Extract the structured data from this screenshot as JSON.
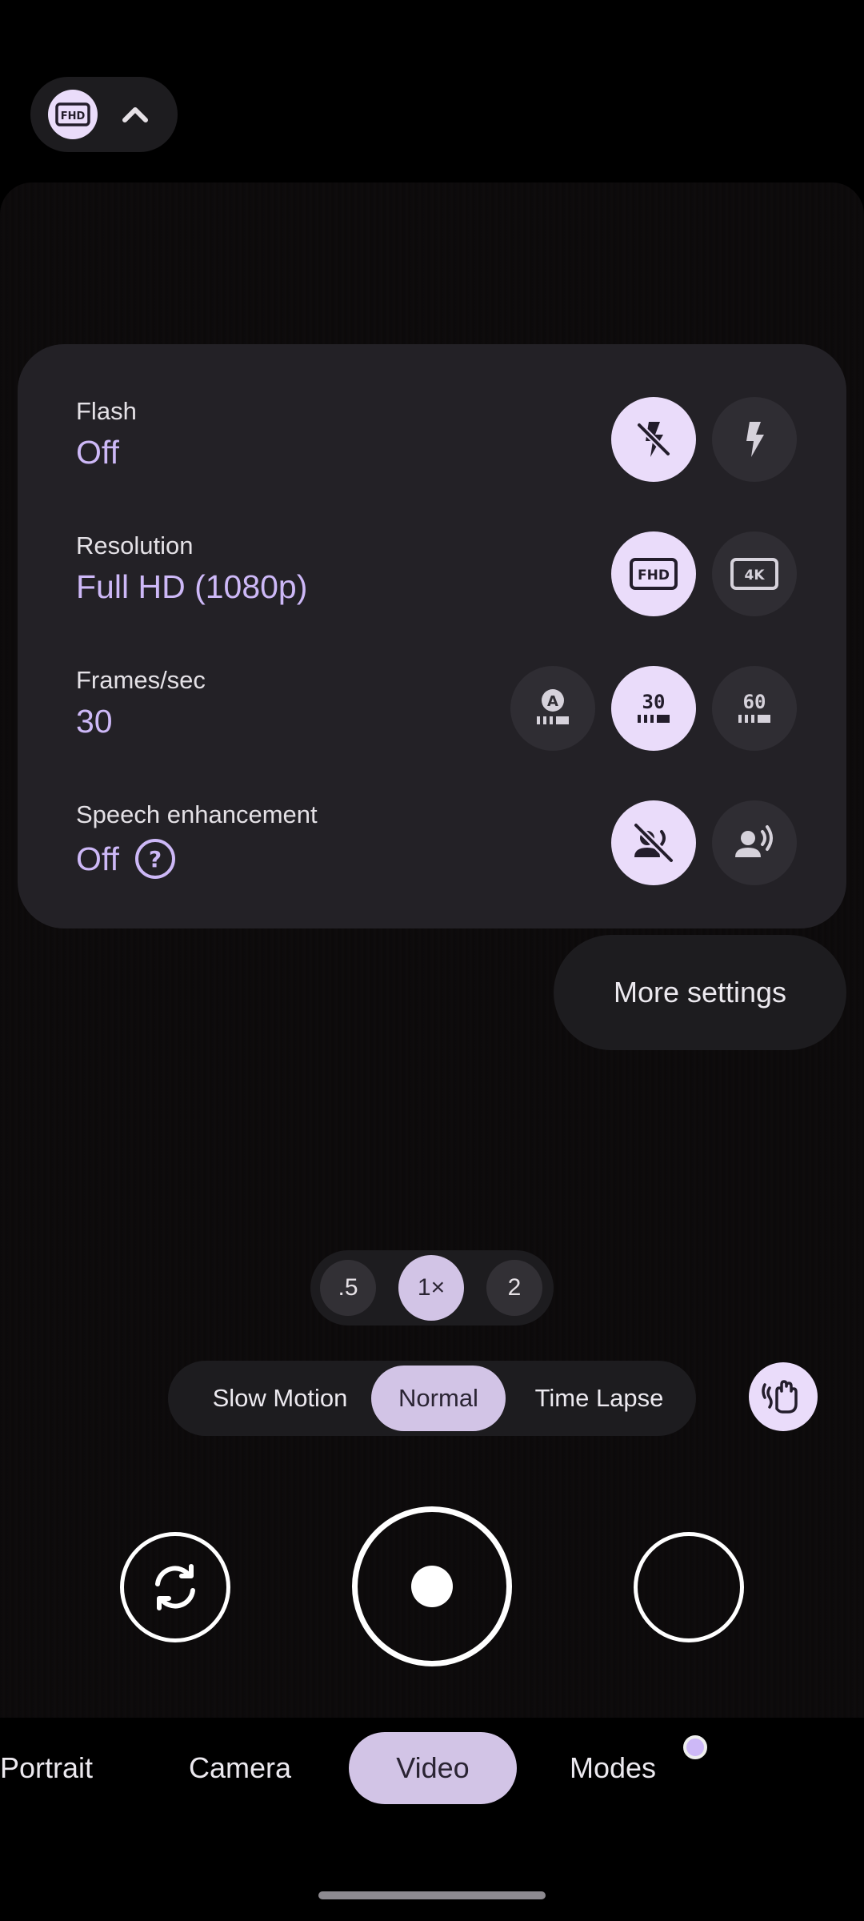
{
  "top_chip": {
    "icon": "fhd-icon",
    "expand_icon": "chevron-up-icon"
  },
  "settings": {
    "flash": {
      "title": "Flash",
      "value": "Off",
      "options": [
        "flash-off-icon",
        "flash-on-icon"
      ]
    },
    "resolution": {
      "title": "Resolution",
      "value": "Full HD (1080p)",
      "options": [
        "fhd-icon",
        "4k-icon"
      ]
    },
    "fps": {
      "title": "Frames/sec",
      "value": "30",
      "options": [
        "fps-auto-icon",
        "fps-30-icon",
        "fps-60-icon"
      ]
    },
    "speech": {
      "title": "Speech enhancement",
      "value": "Off",
      "options": [
        "speech-off-icon",
        "speech-on-icon"
      ]
    }
  },
  "more_settings_label": "More settings",
  "zoom": {
    "options": [
      ".5",
      "1×",
      "2"
    ],
    "selected": "1×"
  },
  "video_modes": {
    "options": [
      "Slow Motion",
      "Normal",
      "Time Lapse"
    ],
    "selected": "Normal"
  },
  "bottom_tabs": {
    "items": [
      "Portrait",
      "Camera",
      "Video",
      "Modes"
    ],
    "selected": "Video"
  },
  "colors": {
    "accent": "#cdb8f7",
    "chip_on": "#eadcfa",
    "pill_active": "#d2c4e6",
    "panel": "#232126"
  }
}
